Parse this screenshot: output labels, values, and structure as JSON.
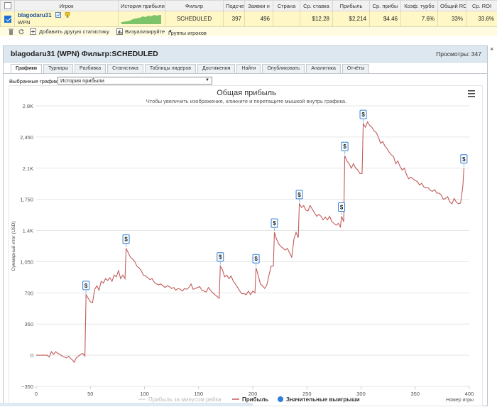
{
  "grid": {
    "headers": [
      "Игрок",
      "История прибыли",
      "Фильтр",
      "Подсчет",
      "Заявки н",
      "Страна",
      "Ср. ставка",
      "Прибыль",
      "Ср. прибы",
      "Коэф. турбо",
      "Общий RO",
      "Ср. ROI"
    ],
    "row": {
      "player": "blagodaru31",
      "network": "WPN",
      "filter": "SCHEDULED",
      "count": "397",
      "entries": "496",
      "country": "",
      "avg_stake": "$12.28",
      "profit": "$2,214",
      "avg_profit": "$4.46",
      "turbo": "7.6%",
      "total_roi": "33%",
      "avg_roi": "33.6%"
    }
  },
  "actions": {
    "add_stats": "Добавить другую статистику",
    "visualize": "Визуализируйте",
    "groups": "Группы игроков"
  },
  "panel": {
    "title": "blagodaru31 (WPN) Фильтр:SCHEDULED",
    "views": "Просмотры: 347",
    "close": "×",
    "tabs": [
      "Графики",
      "Турниры",
      "Разбивка",
      "Статистика",
      "Таблицы лидеров",
      "Достижения",
      "Найти",
      "Опубликовать",
      "Аналитика",
      "Отчёты"
    ],
    "chart_select_label": "Выбранные графики:",
    "chart_select_value": "История прибыли"
  },
  "colors": {
    "line": "#c25b5b",
    "marker": "#2f7ed8",
    "header_bg": "#dde7ef",
    "row_bg": "#fff8c6"
  },
  "chart_data": {
    "type": "line",
    "title": "Общая прибыль",
    "subtitle": "Чтобы увеличить изображение, кликните и перетащите мышкой внутрь графика.",
    "xlabel": "Номер игры",
    "ylabel": "Суммарный итог (USD)",
    "xlim": [
      0,
      400
    ],
    "ylim": [
      -350,
      2800
    ],
    "x_ticks": [
      0,
      50,
      100,
      150,
      200,
      250,
      300,
      350,
      400
    ],
    "y_ticks": [
      -350,
      0,
      350,
      700,
      1050,
      1400,
      1750,
      2100,
      2450,
      2800
    ],
    "y_tick_labels": [
      "−350",
      "0",
      "350",
      "700",
      "1,050",
      "1.4K",
      "1,750",
      "2.1K",
      "2,450",
      "2.8K"
    ],
    "grid": true,
    "legend": {
      "position": "bottom",
      "items": [
        "Прибыль за минусом рейка",
        "Прибыль",
        "Значительные выигрыши"
      ]
    },
    "series": [
      {
        "name": "Прибыль",
        "points": [
          [
            0,
            0
          ],
          [
            5,
            0
          ],
          [
            10,
            0
          ],
          [
            12,
            -20
          ],
          [
            14,
            40
          ],
          [
            16,
            10
          ],
          [
            18,
            40
          ],
          [
            20,
            20
          ],
          [
            22,
            10
          ],
          [
            24,
            -10
          ],
          [
            26,
            -20
          ],
          [
            28,
            -30
          ],
          [
            30,
            -10
          ],
          [
            32,
            -40
          ],
          [
            34,
            -60
          ],
          [
            35,
            -80
          ],
          [
            37,
            -30
          ],
          [
            39,
            -10
          ],
          [
            41,
            10
          ],
          [
            43,
            20
          ],
          [
            45,
            -10
          ],
          [
            46,
            680
          ],
          [
            48,
            640
          ],
          [
            50,
            600
          ],
          [
            52,
            590
          ],
          [
            54,
            740
          ],
          [
            56,
            780
          ],
          [
            58,
            730
          ],
          [
            60,
            830
          ],
          [
            62,
            810
          ],
          [
            64,
            860
          ],
          [
            66,
            840
          ],
          [
            68,
            870
          ],
          [
            70,
            830
          ],
          [
            72,
            900
          ],
          [
            74,
            880
          ],
          [
            76,
            950
          ],
          [
            78,
            860
          ],
          [
            80,
            900
          ],
          [
            82,
            860
          ],
          [
            83,
            1200
          ],
          [
            85,
            1150
          ],
          [
            87,
            1100
          ],
          [
            89,
            1080
          ],
          [
            91,
            1050
          ],
          [
            93,
            1000
          ],
          [
            95,
            980
          ],
          [
            97,
            950
          ],
          [
            99,
            900
          ],
          [
            101,
            890
          ],
          [
            103,
            870
          ],
          [
            105,
            850
          ],
          [
            107,
            860
          ],
          [
            109,
            820
          ],
          [
            111,
            800
          ],
          [
            113,
            790
          ],
          [
            115,
            800
          ],
          [
            117,
            780
          ],
          [
            119,
            760
          ],
          [
            121,
            780
          ],
          [
            123,
            770
          ],
          [
            125,
            750
          ],
          [
            127,
            760
          ],
          [
            129,
            730
          ],
          [
            131,
            750
          ],
          [
            133,
            740
          ],
          [
            135,
            720
          ],
          [
            137,
            750
          ],
          [
            139,
            740
          ],
          [
            141,
            760
          ],
          [
            143,
            800
          ],
          [
            145,
            740
          ],
          [
            147,
            750
          ],
          [
            149,
            760
          ],
          [
            151,
            770
          ],
          [
            153,
            730
          ],
          [
            155,
            720
          ],
          [
            157,
            710
          ],
          [
            159,
            760
          ],
          [
            161,
            730
          ],
          [
            163,
            700
          ],
          [
            165,
            680
          ],
          [
            167,
            660
          ],
          [
            169,
            640
          ],
          [
            170,
            1000
          ],
          [
            172,
            960
          ],
          [
            174,
            880
          ],
          [
            176,
            900
          ],
          [
            178,
            860
          ],
          [
            180,
            890
          ],
          [
            182,
            830
          ],
          [
            184,
            800
          ],
          [
            186,
            760
          ],
          [
            188,
            720
          ],
          [
            190,
            690
          ],
          [
            192,
            690
          ],
          [
            194,
            680
          ],
          [
            196,
            720
          ],
          [
            198,
            680
          ],
          [
            200,
            720
          ],
          [
            202,
            700
          ],
          [
            203,
            980
          ],
          [
            205,
            900
          ],
          [
            207,
            800
          ],
          [
            209,
            780
          ],
          [
            211,
            750
          ],
          [
            213,
            790
          ],
          [
            215,
            900
          ],
          [
            217,
            1000
          ],
          [
            219,
            1000
          ],
          [
            220,
            1380
          ],
          [
            222,
            1300
          ],
          [
            224,
            1250
          ],
          [
            226,
            1220
          ],
          [
            228,
            1200
          ],
          [
            230,
            1180
          ],
          [
            232,
            1200
          ],
          [
            234,
            1150
          ],
          [
            236,
            1100
          ],
          [
            238,
            1300
          ],
          [
            240,
            1380
          ],
          [
            242,
            1320
          ],
          [
            243,
            1700
          ],
          [
            245,
            1660
          ],
          [
            247,
            1680
          ],
          [
            249,
            1630
          ],
          [
            251,
            1620
          ],
          [
            253,
            1680
          ],
          [
            255,
            1640
          ],
          [
            257,
            1600
          ],
          [
            259,
            1560
          ],
          [
            261,
            1580
          ],
          [
            263,
            1560
          ],
          [
            265,
            1520
          ],
          [
            267,
            1550
          ],
          [
            269,
            1520
          ],
          [
            271,
            1560
          ],
          [
            273,
            1500
          ],
          [
            275,
            1480
          ],
          [
            277,
            1460
          ],
          [
            279,
            1480
          ],
          [
            281,
            1440
          ],
          [
            282,
            1560
          ],
          [
            284,
            1500
          ],
          [
            285,
            2240
          ],
          [
            287,
            2180
          ],
          [
            289,
            2150
          ],
          [
            291,
            2100
          ],
          [
            293,
            2150
          ],
          [
            295,
            2100
          ],
          [
            297,
            2080
          ],
          [
            299,
            2040
          ],
          [
            301,
            2040
          ],
          [
            302,
            2600
          ],
          [
            304,
            2560
          ],
          [
            306,
            2620
          ],
          [
            308,
            2580
          ],
          [
            310,
            2560
          ],
          [
            312,
            2520
          ],
          [
            314,
            2500
          ],
          [
            316,
            2450
          ],
          [
            318,
            2380
          ],
          [
            320,
            2400
          ],
          [
            322,
            2350
          ],
          [
            324,
            2320
          ],
          [
            326,
            2280
          ],
          [
            328,
            2250
          ],
          [
            330,
            2230
          ],
          [
            332,
            2150
          ],
          [
            334,
            2180
          ],
          [
            336,
            2120
          ],
          [
            338,
            2080
          ],
          [
            340,
            2100
          ],
          [
            342,
            2030
          ],
          [
            344,
            1980
          ],
          [
            346,
            2000
          ],
          [
            348,
            1980
          ],
          [
            350,
            1960
          ],
          [
            352,
            1950
          ],
          [
            354,
            1910
          ],
          [
            356,
            1930
          ],
          [
            358,
            1890
          ],
          [
            360,
            1880
          ],
          [
            362,
            1880
          ],
          [
            364,
            1850
          ],
          [
            366,
            1840
          ],
          [
            368,
            1860
          ],
          [
            370,
            1820
          ],
          [
            372,
            1820
          ],
          [
            374,
            1800
          ],
          [
            376,
            1750
          ],
          [
            378,
            1760
          ],
          [
            380,
            1780
          ],
          [
            382,
            1720
          ],
          [
            384,
            1700
          ],
          [
            386,
            1760
          ],
          [
            388,
            1720
          ],
          [
            390,
            1700
          ],
          [
            392,
            1710
          ],
          [
            394,
            1900
          ],
          [
            395,
            2100
          ]
        ]
      }
    ],
    "big_wins": [
      {
        "x": 46,
        "y": 680
      },
      {
        "x": 83,
        "y": 1200
      },
      {
        "x": 170,
        "y": 1000
      },
      {
        "x": 203,
        "y": 980
      },
      {
        "x": 220,
        "y": 1380
      },
      {
        "x": 243,
        "y": 1700
      },
      {
        "x": 282,
        "y": 1560
      },
      {
        "x": 285,
        "y": 2240
      },
      {
        "x": 302,
        "y": 2600
      },
      {
        "x": 395,
        "y": 2100
      }
    ],
    "marker_label": "$"
  }
}
